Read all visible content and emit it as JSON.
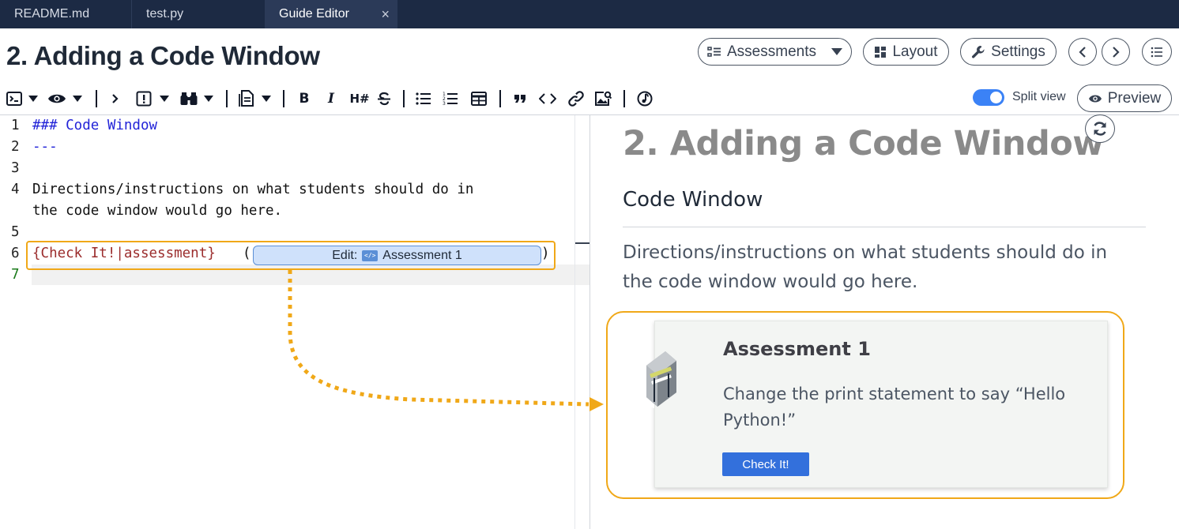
{
  "tabs": [
    {
      "label": "README.md"
    },
    {
      "label": "test.py"
    },
    {
      "label": "Guide Editor",
      "close": "×"
    }
  ],
  "header": {
    "title": "2. Adding a Code Window",
    "assessments_label": "Assessments",
    "layout_label": "Layout",
    "settings_label": "Settings"
  },
  "toolbar": {
    "heading_btn": "H#",
    "split_view_label": "Split view",
    "split_view_on": true,
    "preview_label": "Preview"
  },
  "editor": {
    "line_numbers": [
      "1",
      "2",
      "3",
      "4",
      "",
      "5",
      "6",
      "7"
    ],
    "line1": "### Code Window",
    "line2": "---",
    "line4a": "Directions/instructions on what students should do in",
    "line4b": "the code window would go here.",
    "line6_prefix": "{Check It!|assessment}",
    "line6_open": "(",
    "line6_close": ")",
    "edit_pill_label": "Edit:",
    "edit_pill_name": "Assessment 1"
  },
  "preview": {
    "title": "2. Adding a Code Window",
    "h2": "Code Window",
    "paragraph": "Directions/instructions on what students should do in the code window would go here.",
    "card": {
      "title": "Assessment 1",
      "text": "Change the print statement to say “Hello Python!”",
      "button": "Check It!"
    }
  },
  "colors": {
    "tabbar": "#1c2a44",
    "highlight": "#f0a818",
    "accent": "#3370dc",
    "toggle": "#3b82f6"
  }
}
